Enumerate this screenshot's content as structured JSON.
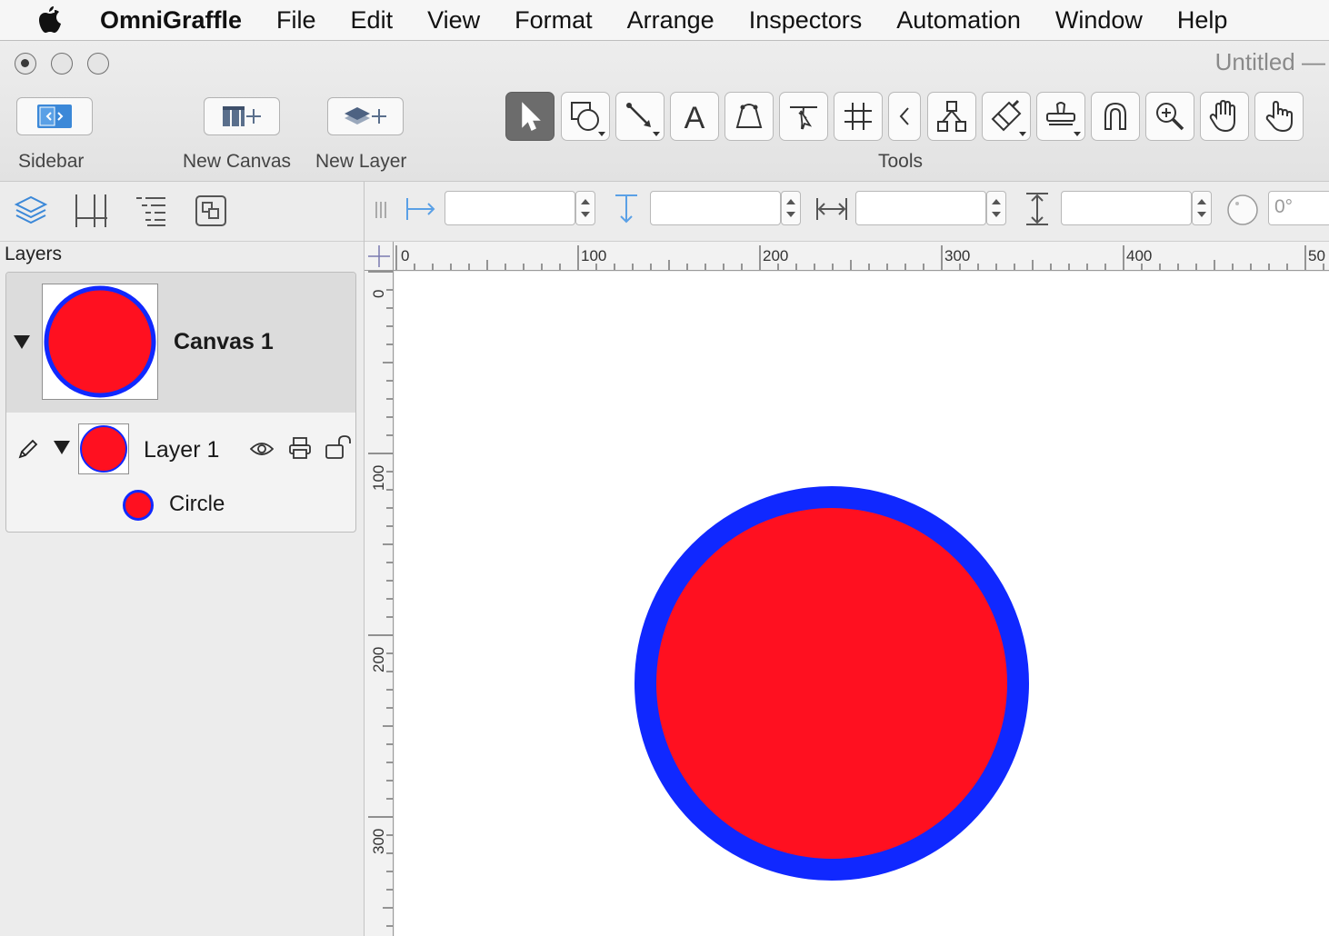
{
  "menubar": {
    "app_name": "OmniGraffle",
    "items": [
      "File",
      "Edit",
      "View",
      "Format",
      "Arrange",
      "Inspectors",
      "Automation",
      "Window",
      "Help"
    ]
  },
  "window": {
    "title": "Untitled —"
  },
  "toolbar": {
    "sidebar_label": "Sidebar",
    "new_canvas_label": "New Canvas",
    "new_layer_label": "New Layer",
    "tools_label": "Tools",
    "tools": [
      {
        "icon": "pointer-icon"
      },
      {
        "icon": "shape-icon"
      },
      {
        "icon": "line-icon"
      },
      {
        "icon": "text-icon"
      },
      {
        "icon": "bezier-icon"
      },
      {
        "icon": "point-editor-icon"
      },
      {
        "icon": "diagram-grid-icon"
      },
      {
        "icon": "collapse-icon"
      },
      {
        "icon": "diagram-tree-icon"
      },
      {
        "icon": "style-brush-icon"
      },
      {
        "icon": "rubber-stamp-icon"
      },
      {
        "icon": "magnet-icon"
      },
      {
        "icon": "zoom-icon"
      },
      {
        "icon": "hand-icon"
      },
      {
        "icon": "browse-hand-icon"
      }
    ]
  },
  "sidebar": {
    "layers_title": "Layers",
    "canvas_name": "Canvas 1",
    "layer_name": "Layer 1",
    "object_name": "Circle"
  },
  "inspector": {
    "x_value": "",
    "y_value": "",
    "width_value": "",
    "height_value": "",
    "rotation_value": "0°"
  },
  "rulers": {
    "top_labels": [
      "0",
      "100",
      "200",
      "300",
      "400",
      "50"
    ],
    "left_labels": [
      "0",
      "100",
      "200",
      "300"
    ]
  },
  "colors": {
    "circle_fill": "#ff1020",
    "circle_stroke": "#1028ff",
    "accent": "#3b88d8"
  }
}
